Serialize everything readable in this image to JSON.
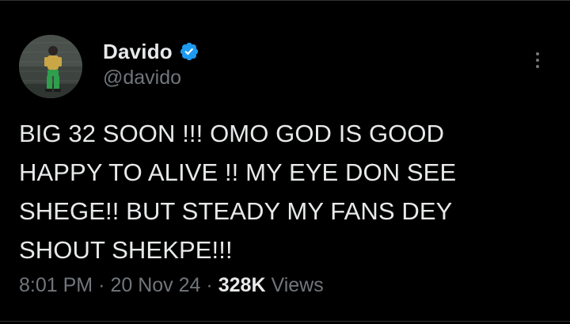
{
  "tweet": {
    "author": {
      "display_name": "Davido",
      "handle": "@davido",
      "verified": true,
      "verified_color": "#1d9bf0"
    },
    "text": "BIG 32 SOON !!! OMO GOD IS GOOD\nHAPPY TO ALIVE !! MY EYE DON SEE\nSHEGE!! BUT STEADY MY FANS DEY\nSHOUT SHEKPE!!!",
    "meta": {
      "time": "8:01 PM",
      "date": "20 Nov 24",
      "separator": "·",
      "views_count": "328K",
      "views_label": "Views"
    },
    "icons": {
      "verified": "verified-badge-icon",
      "more": "more-options-icon"
    }
  },
  "colors": {
    "background": "#000000",
    "primary_text": "#e7e9ea",
    "secondary_text": "#71767b",
    "divider": "#2f3336"
  }
}
